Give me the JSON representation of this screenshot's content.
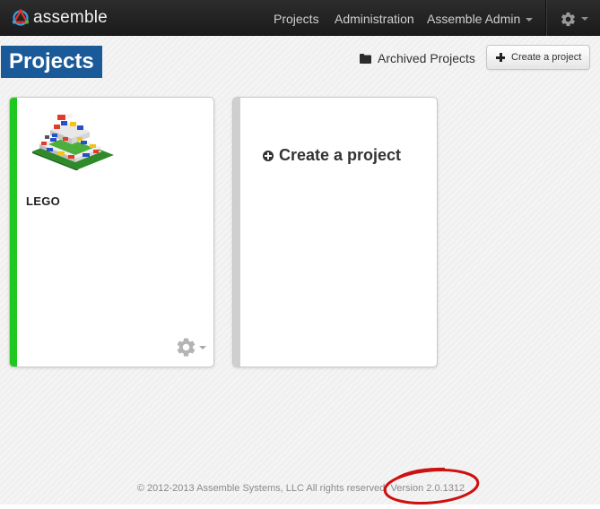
{
  "navbar": {
    "brand": "assemble",
    "links": {
      "projects": "Projects",
      "administration": "Administration",
      "user": "Assemble Admin"
    },
    "icons": {
      "logo": "assemble-logo-icon",
      "settings": "gear-icon"
    }
  },
  "header": {
    "title": "Projects",
    "archived_label": "Archived Projects",
    "create_button_label": "Create a project",
    "icons": {
      "archived": "folder-icon",
      "create": "plus-icon"
    }
  },
  "projects": [
    {
      "name": "LEGO",
      "status_color": "#1fc81f",
      "thumbnail": "lego-model-image",
      "settings_icon": "gear-icon"
    }
  ],
  "new_project_card": {
    "label": "Create a project",
    "icon": "plus-circle-icon",
    "stripe_color": "#cfcfcf"
  },
  "footer": {
    "copyright": "© 2012-2013 Assemble Systems, LLC All rights reserved.",
    "version": "Version 2.0.1312"
  },
  "colors": {
    "navbar_bg": "#1f1f1f",
    "title_bg": "#1b5a99",
    "annotation_circle": "#cc1111"
  }
}
